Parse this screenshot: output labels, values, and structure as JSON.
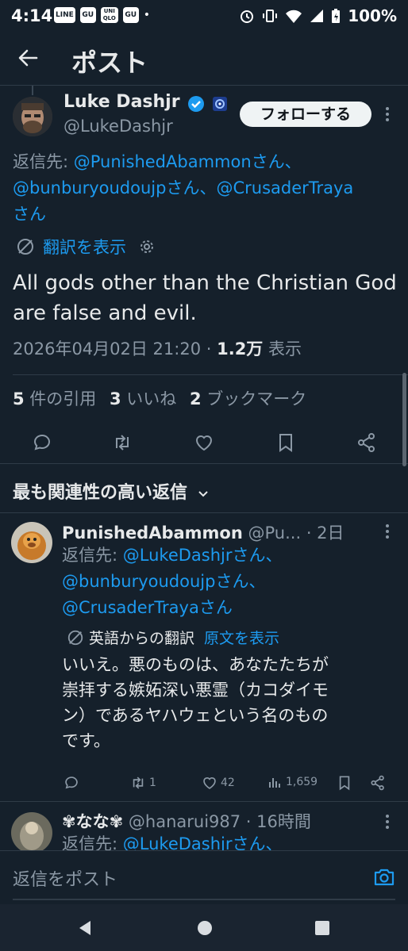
{
  "status_bar": {
    "time": "4:14",
    "apps": [
      "LINE",
      "GU",
      "UNI QLO",
      "GU"
    ],
    "dot": "•",
    "battery": "100%"
  },
  "header": {
    "title": "ポスト"
  },
  "tweet": {
    "author_name": "Luke Dashjr",
    "handle": "@LukeDashjr",
    "follow_label": "フォローする",
    "reply_prefix": "返信先: ",
    "reply_line1_link": "@PunishedAbammonさん、",
    "reply_line2_link": "@bunburyoudoujpさん、@CrusaderTraya",
    "reply_line3_link": "さん",
    "translate_label": "翻訳を表示",
    "text": "All gods other than the Christian God are false and evil.",
    "timestamp": "2026年04月02日 21:20 · ",
    "views": "1.2万",
    "views_label": " 表示",
    "quotes_count": "5",
    "quotes_label": " 件の引用",
    "likes_count": "3",
    "likes_label": " いいね",
    "bookmarks_count": "2",
    "bookmarks_label": " ブックマーク"
  },
  "replies_sort": {
    "label": "最も関連性の高い返信"
  },
  "replies": [
    {
      "name": "PunishedAbammon",
      "handle": "@Pu...",
      "time": " · 2日",
      "reply_prefix": "返信先: ",
      "reply_link1": "@LukeDashjrさん、",
      "reply_link2": "@bunburyoudoujpさん、",
      "reply_link3": "@CrusaderTrayaさん",
      "translation_note": "英語からの翻訳",
      "show_original": "原文を表示",
      "text_line1": "いいえ。悪のものは、あなたたちが",
      "text_line2": "崇拝する嫉妬深い悪霊（カコダイモ",
      "text_line3": "ン）であるヤハウェという名のもの",
      "text_line4": "です。",
      "retweets": "1",
      "likes": "42",
      "views": "1,659"
    },
    {
      "name": "✾なな✾",
      "handle": "@hanarui987",
      "time": " · 16時間",
      "reply_prefix": "返信先: ",
      "reply_link1": "@LukeDashjrさん、"
    }
  ],
  "compose": {
    "placeholder": "返信をポスト"
  }
}
